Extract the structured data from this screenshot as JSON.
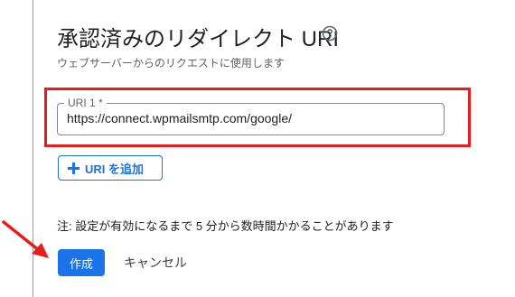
{
  "section": {
    "title": "承認済みのリダイレクト URI",
    "subtitle": "ウェブサーバーからのリクエストに使用します"
  },
  "uri_field": {
    "label": "URI 1 *",
    "value": "https://connect.wpmailsmtp.com/google/"
  },
  "add_button": {
    "label": "URI を追加",
    "icon": "plus-icon"
  },
  "note": "注: 設定が有効になるまで 5 分から数時間かかることがあります",
  "actions": {
    "create_label": "作成",
    "cancel_label": "キャンセル"
  },
  "colors": {
    "accent": "#1a73e8",
    "highlight": "#ea1b1b"
  }
}
